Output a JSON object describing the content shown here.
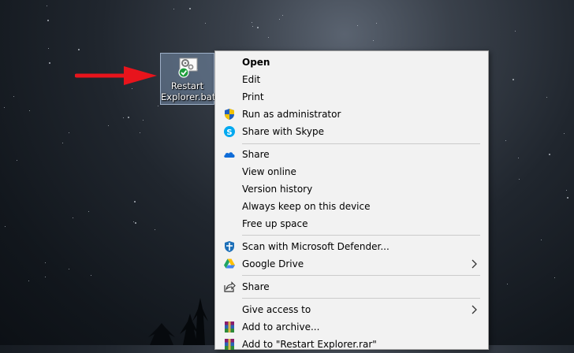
{
  "desktop": {
    "icon": {
      "label_line1": "Restart",
      "label_line2": "Explorer.bat"
    }
  },
  "context_menu": {
    "items": [
      {
        "label": "Open",
        "bold": true
      },
      {
        "label": "Edit"
      },
      {
        "label": "Print"
      },
      {
        "label": "Run as administrator",
        "icon": "uac-shield-icon"
      },
      {
        "label": "Share with Skype",
        "icon": "skype-icon"
      },
      {
        "label": "Share",
        "icon": "onedrive-cloud-icon"
      },
      {
        "label": "View online"
      },
      {
        "label": "Version history"
      },
      {
        "label": "Always keep on this device"
      },
      {
        "label": "Free up space"
      },
      {
        "label": "Scan with Microsoft Defender...",
        "icon": "defender-icon"
      },
      {
        "label": "Google Drive",
        "icon": "google-drive-icon",
        "submenu": true
      },
      {
        "label": "Share",
        "icon": "share-icon"
      },
      {
        "label": "Give access to",
        "submenu": true
      },
      {
        "label": "Add to archive...",
        "icon": "winrar-icon"
      },
      {
        "label": "Add to \"Restart Explorer.rar\"",
        "icon": "winrar-icon"
      }
    ]
  },
  "colors": {
    "annotation_arrow": "#e8141c",
    "menu_background": "#f2f2f2",
    "selection": "#8caacd"
  }
}
